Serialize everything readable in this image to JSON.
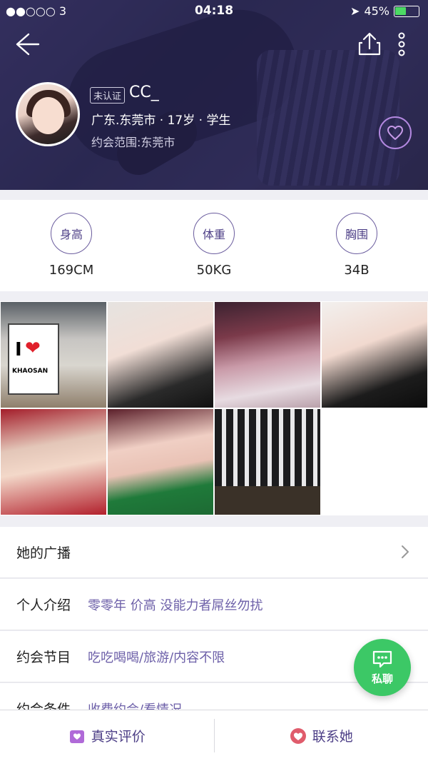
{
  "status": {
    "carrier": "●●○○○ 3",
    "time": "04:18",
    "battery": "45%"
  },
  "header": {
    "badge": "未认证",
    "name": "CC_",
    "info": "广东.东莞市 · 17岁 · 学生",
    "range": "约会范围:东莞市"
  },
  "stats": [
    {
      "label": "身高",
      "value": "169CM"
    },
    {
      "label": "体重",
      "value": "50KG"
    },
    {
      "label": "胸围",
      "value": "34B"
    }
  ],
  "photos": {
    "sign_i": "I",
    "sign_text": "KHAOSAN"
  },
  "rows": {
    "broadcast": {
      "label": "她的广播"
    },
    "intro": {
      "label": "个人介绍",
      "value": "零零年 价高  没能力者屌丝勿扰"
    },
    "program": {
      "label": "约会节目",
      "value": "吃吃喝喝/旅游/内容不限"
    },
    "conditions": {
      "label": "约会条件",
      "value": "收费约会/看情况"
    }
  },
  "fab": {
    "label": "私聊"
  },
  "bottom": {
    "review": "真实评价",
    "contact": "联系她"
  },
  "colors": {
    "accent": "#4c3e86",
    "green": "#3cc866",
    "heart": "#e05c5c"
  }
}
